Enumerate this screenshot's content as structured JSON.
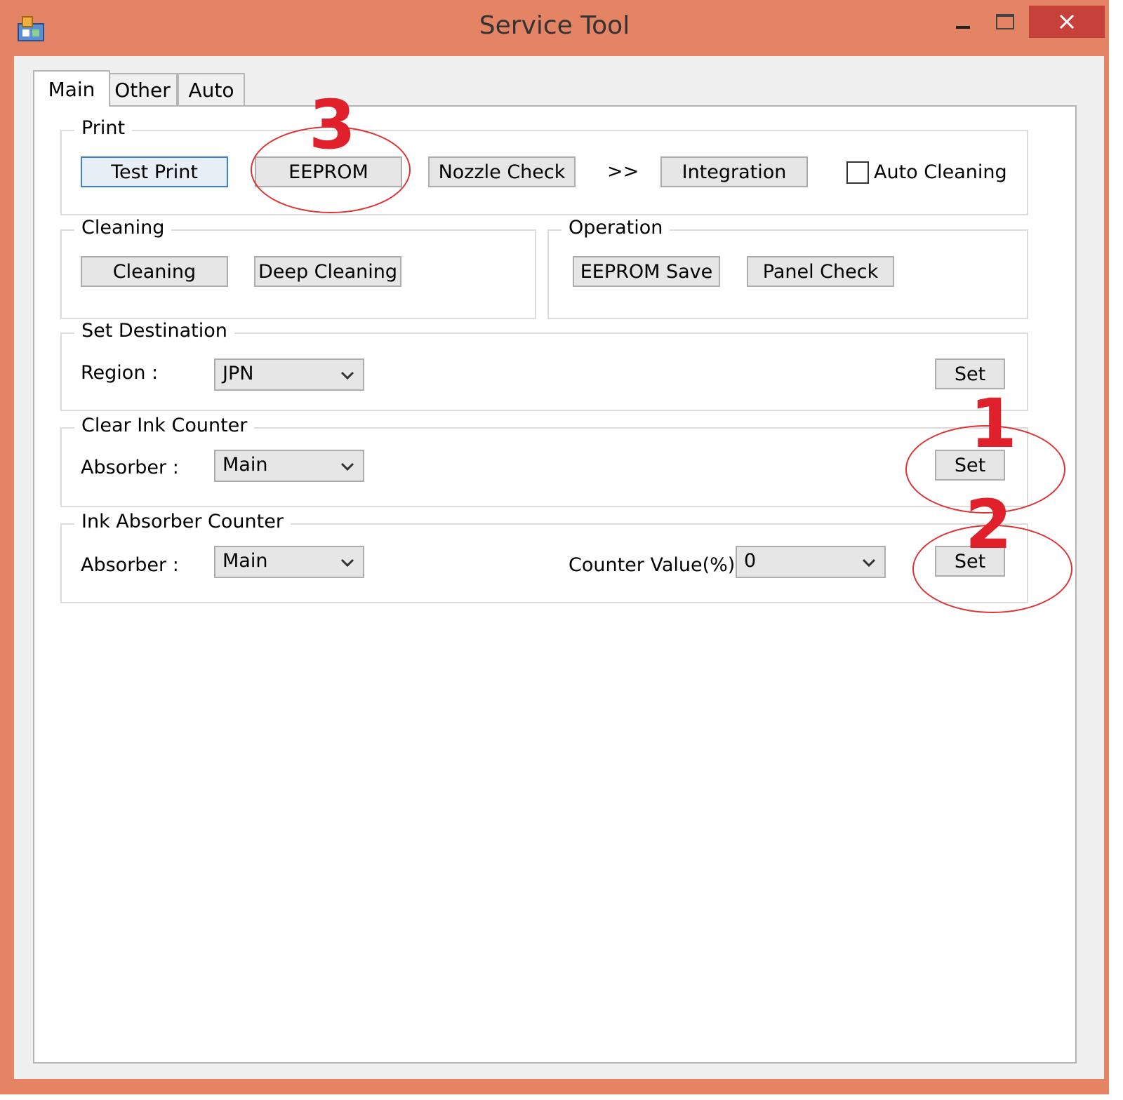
{
  "window": {
    "title": "Service Tool"
  },
  "tabs": [
    {
      "label": "Main",
      "active": true
    },
    {
      "label": "Other",
      "active": false
    },
    {
      "label": "Auto",
      "active": false
    }
  ],
  "print": {
    "legend": "Print",
    "test_print": "Test Print",
    "eeprom": "EEPROM",
    "nozzle_check": "Nozzle Check",
    "arrows": ">>",
    "integration": "Integration",
    "auto_cleaning": "Auto Cleaning",
    "auto_cleaning_checked": false
  },
  "cleaning": {
    "legend": "Cleaning",
    "cleaning": "Cleaning",
    "deep_cleaning": "Deep Cleaning"
  },
  "operation": {
    "legend": "Operation",
    "eeprom_save": "EEPROM Save",
    "panel_check": "Panel Check"
  },
  "set_destination": {
    "legend": "Set Destination",
    "region_label": "Region :",
    "region_value": "JPN",
    "set": "Set"
  },
  "clear_ink_counter": {
    "legend": "Clear Ink Counter",
    "absorber_label": "Absorber :",
    "absorber_value": "Main",
    "set": "Set"
  },
  "ink_absorber_counter": {
    "legend": "Ink Absorber Counter",
    "absorber_label": "Absorber :",
    "absorber_value": "Main",
    "counter_label": "Counter Value(%) :",
    "counter_value": "0",
    "set": "Set"
  },
  "annotations": {
    "one": "1",
    "two": "2",
    "three": "3"
  },
  "colors": {
    "titlebar": "#e58465",
    "close": "#c7413b",
    "annotation": "#e0202a"
  }
}
